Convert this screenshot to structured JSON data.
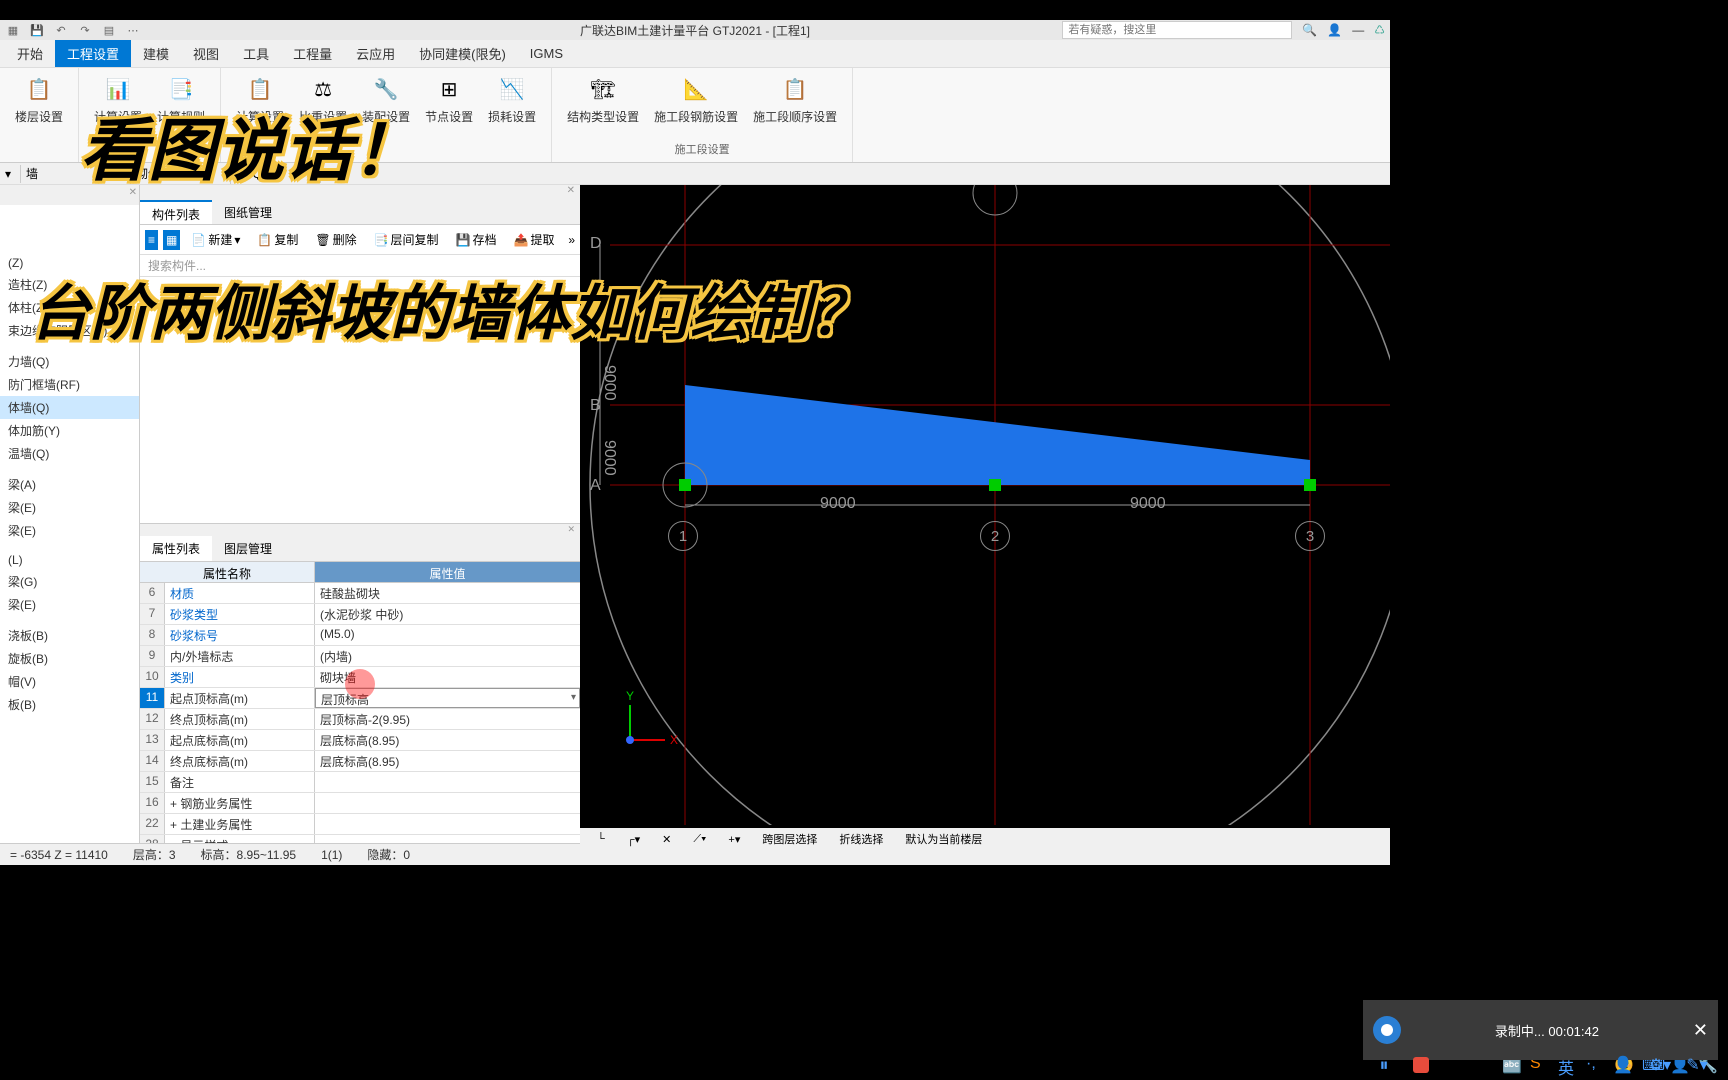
{
  "app": {
    "title": "广联达BIM土建计量平台 GTJ2021 - [工程1]",
    "search_placeholder": "若有疑惑，搜这里"
  },
  "menus": [
    "开始",
    "工程设置",
    "建模",
    "视图",
    "工具",
    "工程量",
    "云应用",
    "协同建模(限免)",
    "IGMS"
  ],
  "active_menu": 1,
  "ribbon_buttons": [
    {
      "label": "楼层设置"
    },
    {
      "label": "计算设置"
    },
    {
      "label": "计算规则"
    },
    {
      "label": "计算设置"
    },
    {
      "label": "比重设置"
    },
    {
      "label": "装配设置"
    },
    {
      "label": "节点设置"
    },
    {
      "label": "损耗设置"
    },
    {
      "label": "结构类型设置"
    },
    {
      "label": "施工段钢筋设置"
    },
    {
      "label": "施工段顺序设置"
    }
  ],
  "ribbon_group_label": "施工段设置",
  "subbar": {
    "item1": "墙",
    "item2": "砌体墙",
    "item3": "QTQ"
  },
  "tree_items": [
    "(Z)",
    "造柱(Z)",
    "体柱(Z)",
    "束边缘非阴影区(Z)",
    "",
    "力墙(Q)",
    "防门框墙(RF)",
    "体墙(Q)",
    "体加筋(Y)",
    "温墙(Q)",
    "",
    "梁(A)",
    "梁(E)",
    "梁(E)",
    "",
    "(L)",
    "梁(G)",
    "梁(E)",
    "",
    "浇板(B)",
    "旋板(B)",
    "帽(V)",
    "板(B)"
  ],
  "tree_selected": 7,
  "mid_tabs": [
    "构件列表",
    "图纸管理"
  ],
  "mid_toolbar": [
    "新建",
    "复制",
    "删除",
    "层间复制",
    "存档",
    "提取"
  ],
  "mid_search_placeholder": "搜索构件...",
  "prop_tabs": [
    "属性列表",
    "图层管理"
  ],
  "prop_header": {
    "name": "属性名称",
    "value": "属性值"
  },
  "prop_rows": [
    {
      "num": "6",
      "name": "材质",
      "value": "硅酸盐砌块",
      "link": true
    },
    {
      "num": "7",
      "name": "砂浆类型",
      "value": "(水泥砂浆 中砂)",
      "link": true
    },
    {
      "num": "8",
      "name": "砂浆标号",
      "value": "(M5.0)",
      "link": true
    },
    {
      "num": "9",
      "name": "内/外墙标志",
      "value": "(内墙)",
      "link": false
    },
    {
      "num": "10",
      "name": "类别",
      "value": "砌块墙",
      "link": true
    },
    {
      "num": "11",
      "name": "起点顶标高(m)",
      "value": "层顶标高",
      "link": false,
      "selected": true
    },
    {
      "num": "12",
      "name": "终点顶标高(m)",
      "value": "层顶标高-2(9.95)",
      "link": false
    },
    {
      "num": "13",
      "name": "起点底标高(m)",
      "value": "层底标高(8.95)",
      "link": false
    },
    {
      "num": "14",
      "name": "终点底标高(m)",
      "value": "层底标高(8.95)",
      "link": false
    },
    {
      "num": "15",
      "name": "备注",
      "value": "",
      "link": false
    },
    {
      "num": "16",
      "name": "钢筋业务属性",
      "value": "",
      "link": false,
      "expand": "+"
    },
    {
      "num": "22",
      "name": "土建业务属性",
      "value": "",
      "link": false,
      "expand": "+"
    },
    {
      "num": "28",
      "name": "显示样式",
      "value": "",
      "link": false,
      "expand": "+"
    }
  ],
  "statusbar": {
    "coords": "= -6354 Z = 11410",
    "floor": "层高：3",
    "elev": "标高：8.95~11.95",
    "count": "1(1)",
    "hidden": "隐藏：0"
  },
  "vp_status": [
    "跨图层选择",
    "折线选择",
    "默认为当前楼层"
  ],
  "viewport": {
    "axes_y": [
      "D",
      "B",
      "A"
    ],
    "axes_x": [
      "1",
      "2",
      "3"
    ],
    "dim_y": "9000",
    "dim_x1": "9000",
    "dim_x2": "9000"
  },
  "overlay": {
    "line1": "看图说话！",
    "line2": "台阶两侧斜坡的墙体如何绘制？"
  },
  "recorder": {
    "text": "录制中... 00:01:42"
  },
  "chart_data": {
    "type": "diagram",
    "description": "CAD floor plan view with triangular wall shape",
    "grid_spacing_x": [
      9000,
      9000
    ],
    "grid_spacing_y": [
      9000,
      9000
    ],
    "axes_horizontal": [
      "1",
      "2",
      "3"
    ],
    "axes_vertical": [
      "A",
      "B",
      "D"
    ],
    "wall_shape": "triangle between axis 1 and 3 along axis A-B"
  }
}
